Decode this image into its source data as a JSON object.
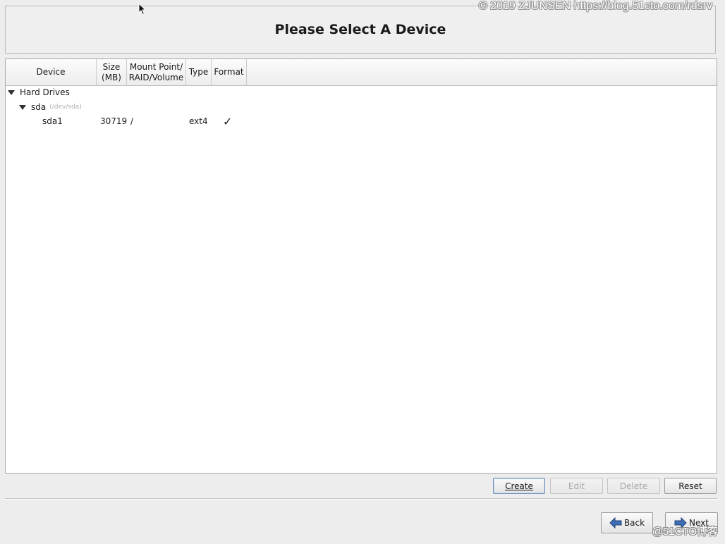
{
  "watermark": {
    "top": "© 2019 ZJUNSEN https://blog.51cto.com/rdsrv",
    "bottom": "@51CTO博客"
  },
  "title": "Please Select A Device",
  "table": {
    "columns": {
      "device": "Device",
      "size_line1": "Size",
      "size_line2": "(MB)",
      "mount_line1": "Mount Point/",
      "mount_line2": "RAID/Volume",
      "type": "Type",
      "format": "Format"
    },
    "group": {
      "label": "Hard Drives"
    },
    "disk": {
      "name": "sda",
      "path": "(/dev/sda)"
    },
    "partition": {
      "name": "sda1",
      "size": "30719",
      "mount": "/",
      "type": "ext4",
      "format": "✓"
    }
  },
  "actions": {
    "create": "Create",
    "edit": "Edit",
    "delete": "Delete",
    "reset": "Reset"
  },
  "nav": {
    "back": "Back",
    "next": "Next"
  },
  "colors": {
    "arrow_blue": "#3d6fb5"
  },
  "icons": {
    "expander": "triangle-down",
    "back": "left-arrow",
    "next": "right-arrow"
  }
}
